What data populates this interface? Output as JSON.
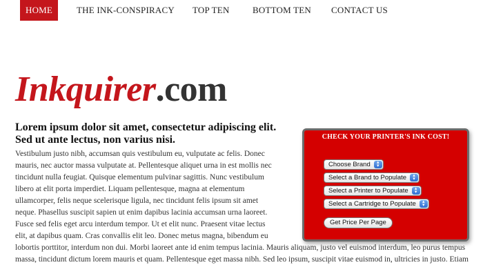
{
  "nav": {
    "items": [
      {
        "label": "HOME",
        "active": true
      },
      {
        "label": "THE INK-CONSPIRACY",
        "active": false
      },
      {
        "label": "TOP TEN",
        "active": false
      },
      {
        "label": "BOTTOM TEN",
        "active": false
      },
      {
        "label": "CONTACT US",
        "active": false
      }
    ]
  },
  "logo": {
    "brand": "Inkquirer",
    "tld": ".com"
  },
  "main": {
    "headline": "Lorem ipsum dolor sit amet, consectetur adipiscing elit. Sed ut ante lectus, non varius nisi.",
    "body_narrow": "Vestibulum justo nibh, accumsan quis vestibulum eu, vulputate ac felis. Donec mauris, nec auctor massa vulputate at. Pellentesque aliquet urna in est mollis nec tincidunt nulla feugiat. Quisque elementum pulvinar sagittis. Nunc vestibulum libero at elit porta imperdiet. Liquam pellentesque, magna at elementum ullamcorper, felis neque scelerisque ligula, nec tincidunt felis ipsum sit amet neque. Phasellus suscipit sapien ut enim dapibus lacinia accumsan urna laoreet. Fusce sed felis eget arcu interdum tempor. Ut et elit nunc. Praesent vitae lectus elit, at dapibus quam. Cras convallis elit leo. Donec metus magna, bibendum eu",
    "body_wide": "lobortis porttitor, interdum non dui. Morbi laoreet ante id enim tempus lacinia. Mauris aliquam, justo vel euismod interdum, leo purus tempus massa, tincidunt dictum lorem mauris et quam. Pellentesque eget massa nibh. Sed leo ipsum, suscipit vitae euismod in, ultricies in justo. Etiam"
  },
  "widget": {
    "title": "CHECK YOUR PRINTER'S INK COST!",
    "brand_select": "Choose Brand",
    "populate_brand_select": "Select a Brand to Populate",
    "printer_select": "Select a Printer to Populate",
    "cartridge_select": "Select a Cartridge to Populate",
    "button_label": "Get Price Per Page"
  },
  "colors": {
    "accent": "#c4161c",
    "widget_bg": "#d40000",
    "text": "#333333"
  }
}
